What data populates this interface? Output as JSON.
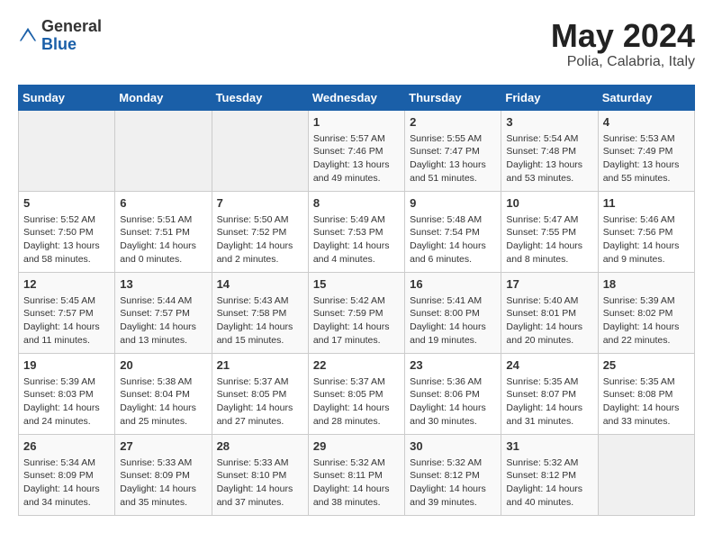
{
  "header": {
    "logo_general": "General",
    "logo_blue": "Blue",
    "month": "May 2024",
    "location": "Polia, Calabria, Italy"
  },
  "weekdays": [
    "Sunday",
    "Monday",
    "Tuesday",
    "Wednesday",
    "Thursday",
    "Friday",
    "Saturday"
  ],
  "weeks": [
    [
      {
        "day": "",
        "empty": true
      },
      {
        "day": "",
        "empty": true
      },
      {
        "day": "",
        "empty": true
      },
      {
        "day": "1",
        "sunrise": "5:57 AM",
        "sunset": "7:46 PM",
        "daylight": "13 hours and 49 minutes."
      },
      {
        "day": "2",
        "sunrise": "5:55 AM",
        "sunset": "7:47 PM",
        "daylight": "13 hours and 51 minutes."
      },
      {
        "day": "3",
        "sunrise": "5:54 AM",
        "sunset": "7:48 PM",
        "daylight": "13 hours and 53 minutes."
      },
      {
        "day": "4",
        "sunrise": "5:53 AM",
        "sunset": "7:49 PM",
        "daylight": "13 hours and 55 minutes."
      }
    ],
    [
      {
        "day": "5",
        "sunrise": "5:52 AM",
        "sunset": "7:50 PM",
        "daylight": "13 hours and 58 minutes."
      },
      {
        "day": "6",
        "sunrise": "5:51 AM",
        "sunset": "7:51 PM",
        "daylight": "14 hours and 0 minutes."
      },
      {
        "day": "7",
        "sunrise": "5:50 AM",
        "sunset": "7:52 PM",
        "daylight": "14 hours and 2 minutes."
      },
      {
        "day": "8",
        "sunrise": "5:49 AM",
        "sunset": "7:53 PM",
        "daylight": "14 hours and 4 minutes."
      },
      {
        "day": "9",
        "sunrise": "5:48 AM",
        "sunset": "7:54 PM",
        "daylight": "14 hours and 6 minutes."
      },
      {
        "day": "10",
        "sunrise": "5:47 AM",
        "sunset": "7:55 PM",
        "daylight": "14 hours and 8 minutes."
      },
      {
        "day": "11",
        "sunrise": "5:46 AM",
        "sunset": "7:56 PM",
        "daylight": "14 hours and 9 minutes."
      }
    ],
    [
      {
        "day": "12",
        "sunrise": "5:45 AM",
        "sunset": "7:57 PM",
        "daylight": "14 hours and 11 minutes."
      },
      {
        "day": "13",
        "sunrise": "5:44 AM",
        "sunset": "7:57 PM",
        "daylight": "14 hours and 13 minutes."
      },
      {
        "day": "14",
        "sunrise": "5:43 AM",
        "sunset": "7:58 PM",
        "daylight": "14 hours and 15 minutes."
      },
      {
        "day": "15",
        "sunrise": "5:42 AM",
        "sunset": "7:59 PM",
        "daylight": "14 hours and 17 minutes."
      },
      {
        "day": "16",
        "sunrise": "5:41 AM",
        "sunset": "8:00 PM",
        "daylight": "14 hours and 19 minutes."
      },
      {
        "day": "17",
        "sunrise": "5:40 AM",
        "sunset": "8:01 PM",
        "daylight": "14 hours and 20 minutes."
      },
      {
        "day": "18",
        "sunrise": "5:39 AM",
        "sunset": "8:02 PM",
        "daylight": "14 hours and 22 minutes."
      }
    ],
    [
      {
        "day": "19",
        "sunrise": "5:39 AM",
        "sunset": "8:03 PM",
        "daylight": "14 hours and 24 minutes."
      },
      {
        "day": "20",
        "sunrise": "5:38 AM",
        "sunset": "8:04 PM",
        "daylight": "14 hours and 25 minutes."
      },
      {
        "day": "21",
        "sunrise": "5:37 AM",
        "sunset": "8:05 PM",
        "daylight": "14 hours and 27 minutes."
      },
      {
        "day": "22",
        "sunrise": "5:37 AM",
        "sunset": "8:05 PM",
        "daylight": "14 hours and 28 minutes."
      },
      {
        "day": "23",
        "sunrise": "5:36 AM",
        "sunset": "8:06 PM",
        "daylight": "14 hours and 30 minutes."
      },
      {
        "day": "24",
        "sunrise": "5:35 AM",
        "sunset": "8:07 PM",
        "daylight": "14 hours and 31 minutes."
      },
      {
        "day": "25",
        "sunrise": "5:35 AM",
        "sunset": "8:08 PM",
        "daylight": "14 hours and 33 minutes."
      }
    ],
    [
      {
        "day": "26",
        "sunrise": "5:34 AM",
        "sunset": "8:09 PM",
        "daylight": "14 hours and 34 minutes."
      },
      {
        "day": "27",
        "sunrise": "5:33 AM",
        "sunset": "8:09 PM",
        "daylight": "14 hours and 35 minutes."
      },
      {
        "day": "28",
        "sunrise": "5:33 AM",
        "sunset": "8:10 PM",
        "daylight": "14 hours and 37 minutes."
      },
      {
        "day": "29",
        "sunrise": "5:32 AM",
        "sunset": "8:11 PM",
        "daylight": "14 hours and 38 minutes."
      },
      {
        "day": "30",
        "sunrise": "5:32 AM",
        "sunset": "8:12 PM",
        "daylight": "14 hours and 39 minutes."
      },
      {
        "day": "31",
        "sunrise": "5:32 AM",
        "sunset": "8:12 PM",
        "daylight": "14 hours and 40 minutes."
      },
      {
        "day": "",
        "empty": true
      }
    ]
  ]
}
